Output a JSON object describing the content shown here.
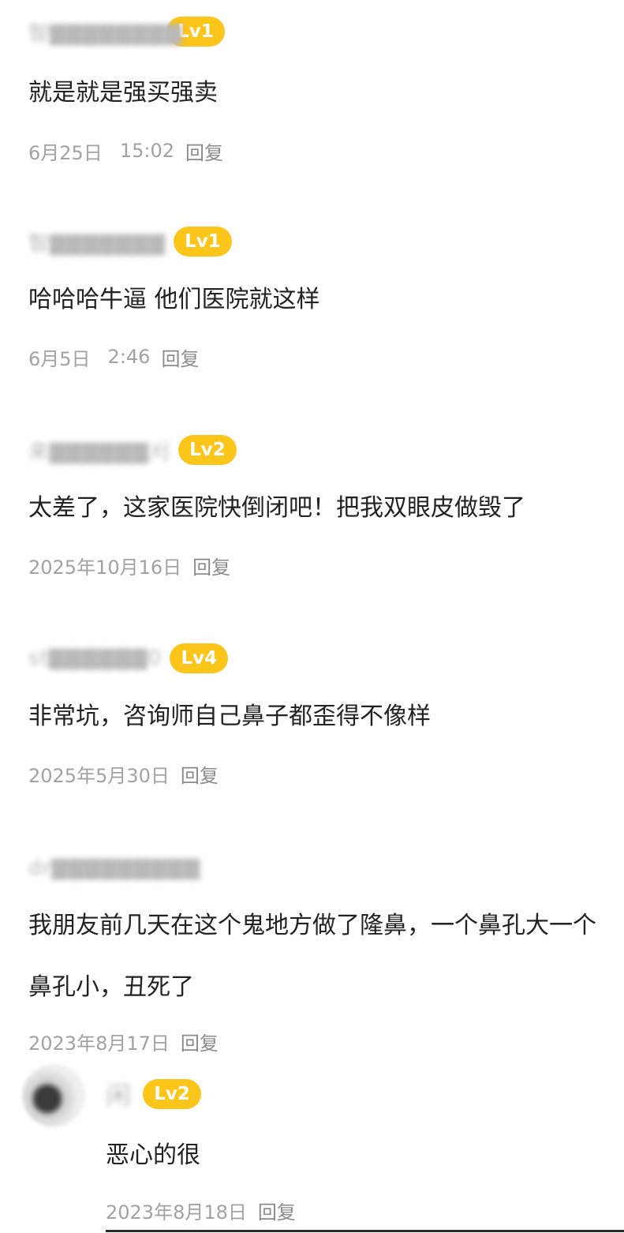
{
  "comments": [
    {
      "username": "智▇▇▇▇▇▇▇▇",
      "level": "Lv1",
      "content": "就是就是强买强卖",
      "date": "6月25日",
      "time": "15:02",
      "reply_label": "回复"
    },
    {
      "username": "智▇▇▇▇▇▇▇",
      "level": "Lv1",
      "content": "哈哈哈牛逼 他们医院就这样",
      "date": "6月5日",
      "time": "2:46",
      "reply_label": "回复"
    },
    {
      "username": "来▇▇▇▇▇▇刈",
      "level": "Lv2",
      "content": "太差了，这家医院快倒闭吧！把我双眼皮做毁了",
      "date": "2025年10月16日",
      "reply_label": "回复"
    },
    {
      "username": "st▇▇▇▇▇▇0",
      "level": "Lv4",
      "content": "非常坑，咨询师自己鼻子都歪得不像样",
      "date": "2025年5月30日",
      "reply_label": "回复"
    },
    {
      "username": "dr▇▇▇▇▇▇▇▇▇",
      "content": "我朋友前几天在这个鬼地方做了隆鼻，一个鼻孔大一个鼻孔小，丑死了",
      "date": "2023年8月17日",
      "reply_label": "回复"
    }
  ],
  "reply": {
    "username": "闲",
    "level": "Lv2",
    "content": "恶心的很",
    "date": "2023年8月18日",
    "reply_label": "回复"
  },
  "colors": {
    "badge": "#fcc51a",
    "text": "#222222",
    "meta": "#a2a2a2"
  }
}
